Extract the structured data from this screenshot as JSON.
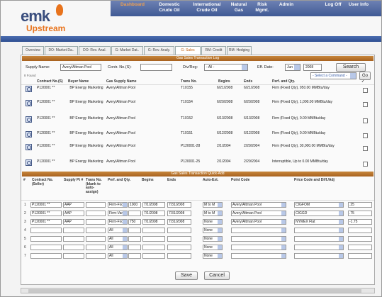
{
  "app": {
    "logo_text": "emk",
    "logo_sub": "Upstream"
  },
  "topnav": {
    "items": [
      {
        "label": "Dashboard",
        "active": true
      },
      {
        "label": "Domestic Crude Oil"
      },
      {
        "label": "International Crude Oil"
      },
      {
        "label": "Natural Gas"
      },
      {
        "label": "Risk Mgmt."
      },
      {
        "label": "Admin"
      },
      {
        "label": "Log Off"
      },
      {
        "label": "User Info"
      }
    ]
  },
  "tabs": [
    {
      "label": "Overview"
    },
    {
      "label": "DO: Market Da.."
    },
    {
      "label": "DO: Rev. Anal."
    },
    {
      "label": "G: Market Dat.."
    },
    {
      "label": "G: Rev. Analy."
    },
    {
      "label": "G: Sales",
      "active": true
    },
    {
      "label": "RM: Credit"
    },
    {
      "label": "RM: Hedging"
    }
  ],
  "log": {
    "title": "Gas Sales Transaction Log",
    "supply_name_label": "Supply Name:",
    "supply_name_value": "Avery/Altman Pool",
    "contr_label": "Contr. No.(S):",
    "contr_value": "",
    "div_label": "Div/Reg:",
    "div_value": "- All -",
    "eff_label": "Eff. Date:",
    "eff_month": "Jun",
    "eff_year": "2008",
    "search_label": "Search",
    "found_label": "8 Found",
    "command_placeholder": "- Select a Command -",
    "go_label": "Go",
    "columns": [
      "Contract No.(S)",
      "Buyer Name",
      "Gas Supply Name",
      "Trans No.",
      "Begins",
      "Ends",
      "Perf. and Qty.",
      "✓"
    ],
    "rows": [
      {
        "contract": "P120001 **",
        "buyer": "BP Energy Marketing",
        "supply": "Avery/Altman Pool",
        "trans": "T10155",
        "begins": "6/21/2008",
        "ends": "6/21/2008",
        "perf": "Firm (Fixed Qty), 950.00 MMBtu/day"
      },
      {
        "contract": "P120001 **",
        "buyer": "BP Energy Marketing",
        "supply": "Avery/Altman Pool",
        "trans": "T10154",
        "begins": "6/20/2008",
        "ends": "6/20/2008",
        "perf": "Firm (Fixed Qty), 1,000.00 MMBtu/day"
      },
      {
        "contract": "P120001 **",
        "buyer": "BP Energy Marketing",
        "supply": "Avery/Altman Pool",
        "trans": "T10152",
        "begins": "6/13/2008",
        "ends": "6/13/2008",
        "perf": "Firm (Fixed Qty), 0.00 MMBtu/day"
      },
      {
        "contract": "P120001 **",
        "buyer": "BP Energy Marketing",
        "supply": "Avery/Altman Pool",
        "trans": "T10151",
        "begins": "6/12/2008",
        "ends": "6/12/2008",
        "perf": "Firm (Fixed Qty), 0.00 MMBtu/day"
      },
      {
        "contract": "P120001 **",
        "buyer": "BP Energy Marketing",
        "supply": "Avery/Altman Pool",
        "trans": "P120001-28",
        "begins": "2/1/2004",
        "ends": "2/29/2004",
        "perf": "Firm (Fixed Qty), 30,000.00 MMBtu/day"
      },
      {
        "contract": "P120001 **",
        "buyer": "BP Energy Marketing",
        "supply": "Avery/Altman Pool",
        "trans": "P120001-25",
        "begins": "2/1/2004",
        "ends": "2/29/2004",
        "perf": "Interruptible, Up to 0.00 MMBtu/day"
      }
    ]
  },
  "quick": {
    "title": "Gas Sales Transaction Quick-Add",
    "columns": [
      "#",
      "Contract No. (Seller)",
      "Supply Pt #",
      "Trans No. (blank to auto-assign)",
      "Perf. and Qty.",
      "Begins",
      "Ends",
      "Auto-Ext.",
      "Point Code",
      "Price Code and Diff./Adj"
    ],
    "rows": [
      {
        "num": "1",
        "contract": "P120001 **",
        "supply": "AAP",
        "trans": "",
        "perf": "Firm-Fxd",
        "qty": "1000",
        "begins": "7/1/2008",
        "ends": "7/31/2008",
        "ext": "M to M",
        "point": "Avery/Altman Pool",
        "price": "CIGFOM",
        "diff": ".25"
      },
      {
        "num": "2",
        "contract": "P120001 **",
        "supply": "AAP",
        "trans": "",
        "perf": "Firm-Var",
        "qty": "",
        "begins": "7/1/2008",
        "ends": "7/31/2008",
        "ext": "M to M",
        "point": "Avery/Altman Pool",
        "price": "CIGGD",
        "diff": ".75"
      },
      {
        "num": "3",
        "contract": "P120001 **",
        "supply": "AAP",
        "trans": "",
        "perf": "Firm-Fxd",
        "qty": "750",
        "begins": "7/1/2008",
        "ends": "7/31/2008",
        "ext": "None",
        "point": "Avery/Altman Pool",
        "price": "NYMEX Flat",
        "diff": "-1.75"
      },
      {
        "num": "4",
        "contract": "",
        "supply": "",
        "trans": "",
        "perf": "All",
        "qty": "",
        "begins": "",
        "ends": "",
        "ext": "None",
        "point": "",
        "price": "",
        "diff": ""
      },
      {
        "num": "5",
        "contract": "",
        "supply": "",
        "trans": "",
        "perf": "All",
        "qty": "",
        "begins": "",
        "ends": "",
        "ext": "None",
        "point": "",
        "price": "",
        "diff": ""
      },
      {
        "num": "6",
        "contract": "",
        "supply": "",
        "trans": "",
        "perf": "All",
        "qty": "",
        "begins": "",
        "ends": "",
        "ext": "None",
        "point": "",
        "price": "",
        "diff": ""
      },
      {
        "num": "7",
        "contract": "",
        "supply": "",
        "trans": "",
        "perf": "All",
        "qty": "",
        "begins": "",
        "ends": "",
        "ext": "None",
        "point": "",
        "price": "",
        "diff": ""
      }
    ],
    "save_label": "Save",
    "cancel_label": "Cancel"
  },
  "colors": {
    "nav": "#405a95",
    "accent": "#e8731c",
    "section": "#b3702b"
  }
}
